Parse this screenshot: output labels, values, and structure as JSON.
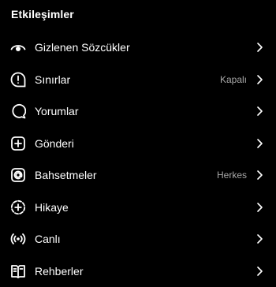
{
  "header": {
    "title": "Etkileşimler"
  },
  "items": [
    {
      "label": "Gizlenen Sözcükler",
      "value": "",
      "icon": "eye-off-icon"
    },
    {
      "label": "Sınırlar",
      "value": "Kapalı",
      "icon": "alert-circle-icon"
    },
    {
      "label": "Yorumlar",
      "value": "",
      "icon": "comment-icon"
    },
    {
      "label": "Gönderi",
      "value": "",
      "icon": "plus-square-icon"
    },
    {
      "label": "Bahsetmeler",
      "value": "Herkes",
      "icon": "mention-icon"
    },
    {
      "label": "Hikaye",
      "value": "",
      "icon": "story-plus-icon"
    },
    {
      "label": "Canlı",
      "value": "",
      "icon": "live-broadcast-icon"
    },
    {
      "label": "Rehberler",
      "value": "",
      "icon": "guide-book-icon"
    }
  ],
  "colors": {
    "background": "#000000",
    "text": "#ffffff",
    "muted": "#a8a8a8"
  }
}
